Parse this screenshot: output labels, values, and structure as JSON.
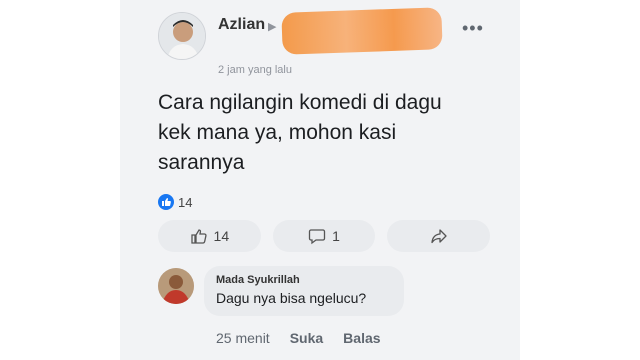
{
  "post": {
    "author": "Azlian",
    "time": "2 jam yang lalu",
    "text": "Cara ngilangin komedi di dagu kek mana ya, mohon kasi sarannya",
    "reaction_count": "14",
    "like_count": "14",
    "comment_count": "1",
    "more_label": "•••"
  },
  "comment": {
    "author": "Mada Syukrillah",
    "text": "Dagu nya bisa ngelucu?",
    "time": "25 menit",
    "like_label": "Suka",
    "reply_label": "Balas"
  },
  "colors": {
    "accent": "#1877f2",
    "redaction": "#f59a4e"
  }
}
